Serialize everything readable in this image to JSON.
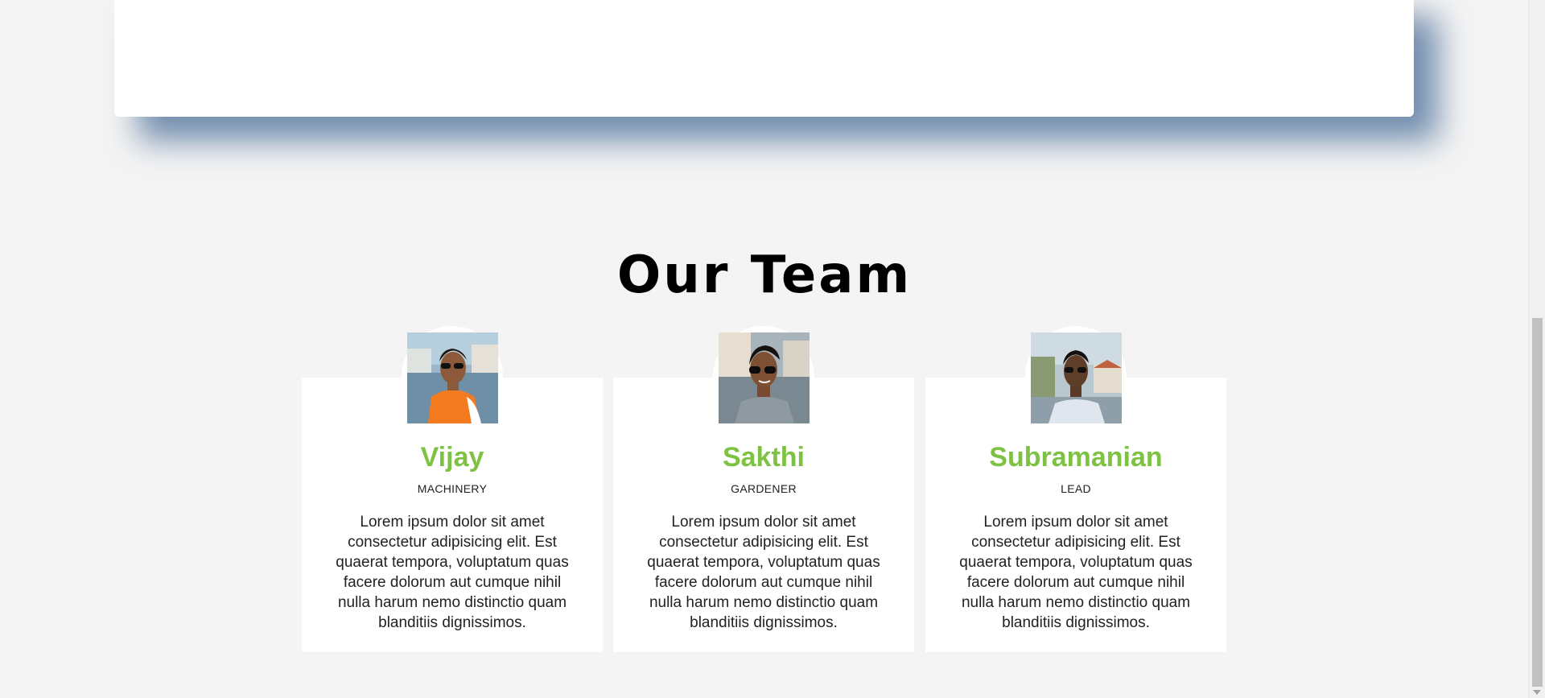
{
  "section": {
    "title": "Our Team"
  },
  "team": [
    {
      "name": "Vijay",
      "role": "MACHINERY",
      "bio": "Lorem ipsum dolor sit amet consectetur adipisicing elit. Est quaerat tempora, voluptatum quas facere dolorum aut cumque nihil nulla harum nemo distinctio quam blanditiis dignissimos."
    },
    {
      "name": "Sakthi",
      "role": "GARDENER",
      "bio": "Lorem ipsum dolor sit amet consectetur adipisicing elit. Est quaerat tempora, voluptatum quas facere dolorum aut cumque nihil nulla harum nemo distinctio quam blanditiis dignissimos."
    },
    {
      "name": "Subramanian",
      "role": "LEAD",
      "bio": "Lorem ipsum dolor sit amet consectetur adipisicing elit. Est quaerat tempora, voluptatum quas facere dolorum aut cumque nihil nulla harum nemo distinctio quam blanditiis dignissimos."
    }
  ],
  "colors": {
    "accent": "#7dc242",
    "background": "#f4f4f4",
    "card": "#ffffff",
    "shadow": "#466996"
  },
  "icons": {
    "scroll_down": "scroll-down-arrow-icon"
  }
}
